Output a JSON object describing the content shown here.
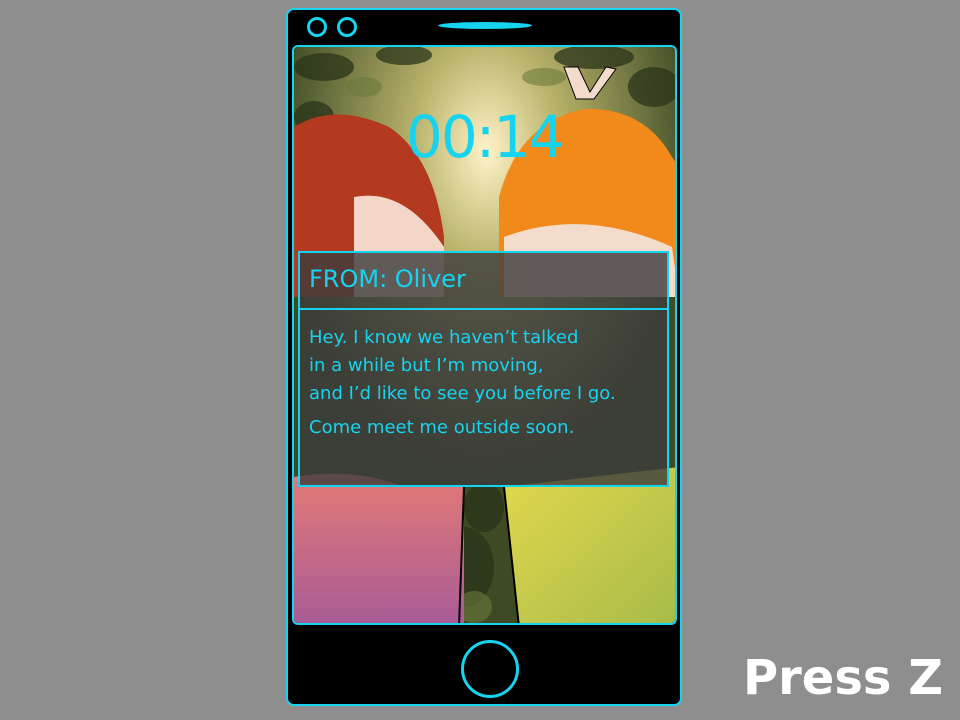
{
  "phone": {
    "clock": "00:14"
  },
  "message": {
    "from": "FROM: Oliver",
    "lines": [
      "Hey. I know we haven’t talked",
      "in a while but I’m moving,",
      "and I’d like to see you before I go.",
      "Come meet me outside soon."
    ]
  },
  "prompt": {
    "label": "Press Z"
  },
  "colors": {
    "accent": "#16d3f0",
    "background": "#8e8e8e"
  }
}
